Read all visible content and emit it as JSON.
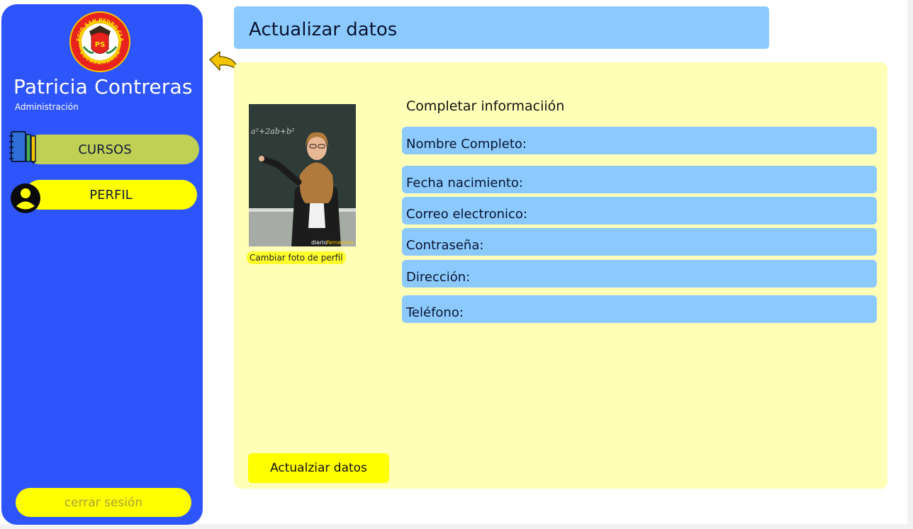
{
  "sidebar": {
    "user_name": "Patricia Contreras",
    "user_role": "Administración",
    "logo_text_top": "COLEGIO SAN PEDRO CLAVER",
    "logo_text_bottom": "BUCARAMANGA",
    "logo_monogram": "PS",
    "nav": [
      {
        "label": "CURSOS",
        "icon": "books-pencils-icon"
      },
      {
        "label": "PERFIL",
        "icon": "user-icon"
      }
    ],
    "logout_label": "cerrar sesión"
  },
  "header": {
    "title": "Actualizar datos"
  },
  "back_icon": "back-arrow-icon",
  "profile": {
    "photo_watermark_a": "diario",
    "photo_watermark_b": "femenino",
    "change_photo_label": "Cambiar foto de perfil"
  },
  "form": {
    "title": "Completar informaciión",
    "fields": [
      {
        "label": "Nombre Completo:"
      },
      {
        "label": "Fecha nacimiento:"
      },
      {
        "label": "Correo electronico:"
      },
      {
        "label": "Contraseña:"
      },
      {
        "label": "Dirección:"
      },
      {
        "label": "Teléfono:"
      }
    ],
    "submit_label": "Actualziar datos"
  },
  "colors": {
    "sidebar": "#2e55fb",
    "accent_yellow": "#ffff00",
    "field_blue": "#8ccafe",
    "card": "#ffffb7",
    "cursos_green": "#c0d054"
  }
}
